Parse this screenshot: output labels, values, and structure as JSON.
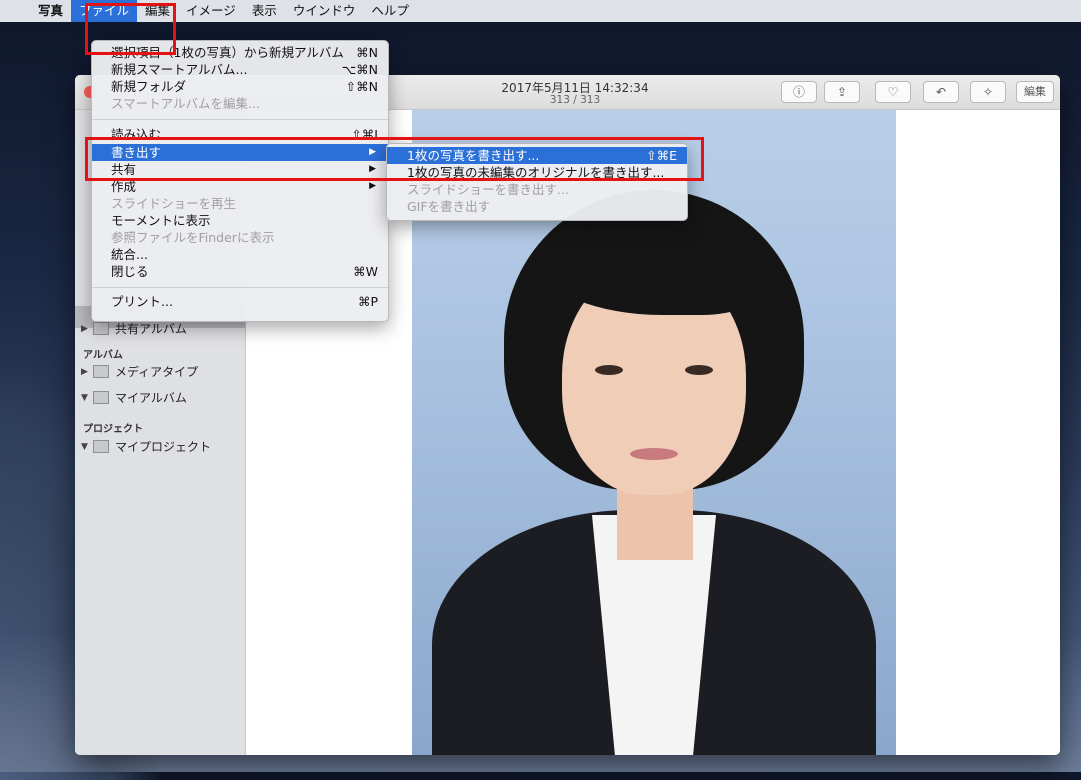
{
  "menubar": {
    "apple": "",
    "app": "写真",
    "items": [
      "ファイル",
      "編集",
      "イメージ",
      "表示",
      "ウインドウ",
      "ヘルプ"
    ]
  },
  "window": {
    "title": "2017年5月11日 14:32:34",
    "subtitle": "313 / 313",
    "toolbar": {
      "info_icon": "ⓘ",
      "share_icon": "⇪",
      "favorite_icon": "♡",
      "rotate_icon": "↶",
      "enhance_icon": "✧",
      "edit_label": "編集"
    }
  },
  "sidebar": {
    "hidden_row": "共有アルバム",
    "section_albums": "アルバム",
    "albums": [
      "メディアタイプ",
      "マイアルバム"
    ],
    "section_projects": "プロジェクト",
    "projects": [
      "マイプロジェクト"
    ]
  },
  "file_menu": {
    "items": [
      {
        "label": "選択項目（1枚の写真）から新規アルバム",
        "shortcut": "⌘N"
      },
      {
        "label": "新規スマートアルバム...",
        "shortcut": "⌥⌘N"
      },
      {
        "label": "新規フォルダ",
        "shortcut": "⇧⌘N"
      },
      {
        "label": "スマートアルバムを編集...",
        "shortcut": ""
      },
      {
        "label": "読み込む...",
        "shortcut": "⇧⌘I"
      },
      {
        "label": "書き出す",
        "shortcut": "▶"
      },
      {
        "label": "共有",
        "shortcut": "▶"
      },
      {
        "label": "作成",
        "shortcut": "▶"
      },
      {
        "label": "スライドショーを再生",
        "shortcut": ""
      },
      {
        "label": "モーメントに表示",
        "shortcut": ""
      },
      {
        "label": "参照ファイルをFinderに表示",
        "shortcut": ""
      },
      {
        "label": "統合...",
        "shortcut": ""
      },
      {
        "label": "閉じる",
        "shortcut": "⌘W"
      },
      {
        "label": "プリント...",
        "shortcut": "⌘P"
      }
    ]
  },
  "export_submenu": {
    "items": [
      {
        "label": "1枚の写真を書き出す...",
        "shortcut": "⇧⌘E"
      },
      {
        "label": "1枚の写真の未編集のオリジナルを書き出す...",
        "shortcut": ""
      },
      {
        "label": "スライドショーを書き出す...",
        "shortcut": ""
      },
      {
        "label": "GIFを書き出す",
        "shortcut": ""
      }
    ]
  },
  "colors": {
    "selection": "#2b6fd8",
    "highlight_box": "#e51212"
  }
}
